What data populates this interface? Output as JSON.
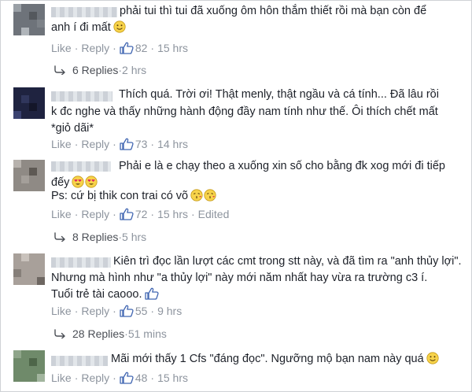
{
  "comments": [
    {
      "lines": [
        "phải tui thì tui đã xuống ôm hôn thắm thiết rồi mà bạn còn để",
        "anh í đi mất"
      ],
      "like_label": "Like",
      "reply_label": "Reply",
      "likes": "82",
      "time": "15 hrs",
      "replies": "6 Replies",
      "replies_time": "2 hrs"
    },
    {
      "lines": [
        "Thích quá. Trời ơi! Thật menly, thật ngầu và cá tính... Đã lâu rồi",
        "k đc nghe và thấy những hành động đầy nam tính như thế. Ôi thích chết mất",
        "*giỏ dãi*"
      ],
      "like_label": "Like",
      "reply_label": "Reply",
      "likes": "73",
      "time": "14 hrs"
    },
    {
      "lines": [
        "Phải e là e chạy theo a xuống xin số cho bằng đk xog mới đi tiếp",
        "đếy",
        "Ps: cứ bị thik con trai có võ"
      ],
      "like_label": "Like",
      "reply_label": "Reply",
      "likes": "72",
      "time": "15 hrs",
      "edited": "Edited",
      "replies": "8 Replies",
      "replies_time": "5 hrs"
    },
    {
      "lines": [
        "Kiên trì đọc lần lượt các cmt trong stt này, và đã tìm ra \"anh thủy lợi\".",
        "Nhưng mà hình như \"a thủy lợi\" này mới năm nhất hay vừa ra trường c3 í.",
        "Tuổi trẻ tài caooo."
      ],
      "like_label": "Like",
      "reply_label": "Reply",
      "likes": "55",
      "time": "9 hrs",
      "replies": "28 Replies",
      "replies_time": "51 mins"
    },
    {
      "lines": [
        "Mãi mới thấy 1 Cfs \"đáng đọc\". Ngưỡng mộ bạn nam này quá"
      ],
      "like_label": "Like",
      "reply_label": "Reply",
      "likes": "48",
      "time": "15 hrs"
    }
  ],
  "colors": {
    "link": "#4b67a1",
    "meta": "#8d949e",
    "like_blue": "#4267b2",
    "text": "#1d2129"
  },
  "icons": [
    "thumbs-up-icon",
    "reply-arrow-icon",
    "smile-emoji",
    "heart-eyes-emoji",
    "kiss-emoji",
    "thumbs-up-emoji"
  ]
}
